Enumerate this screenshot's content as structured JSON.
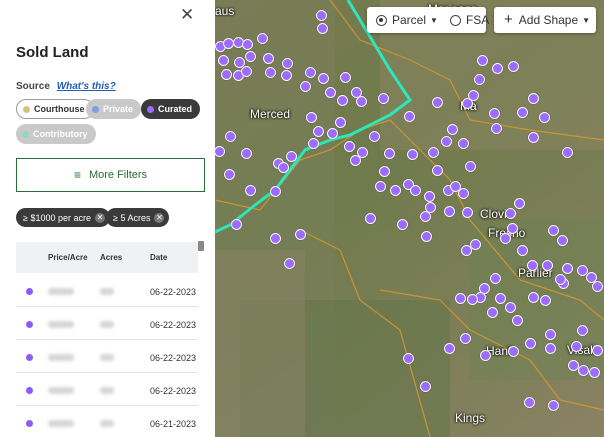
{
  "panel": {
    "title": "Sold Land",
    "source_label": "Source",
    "whats_this": "What's this?",
    "source_chips": [
      {
        "label": "Courthouse",
        "dot": "#d9c08a",
        "state": "outline"
      },
      {
        "label": "Private",
        "dot": "#7aa2e0",
        "state": "disabled"
      },
      {
        "label": "Curated",
        "dot": "#9d6bff",
        "state": "selected"
      },
      {
        "label": "Contributory",
        "dot": "#8fd6c8",
        "state": "disabled"
      }
    ],
    "more_filters": "More Filters",
    "active_filters": [
      "≥ $1000 per acre",
      "≥ 5 Acres"
    ],
    "table": {
      "columns": [
        "Price/Acre",
        "Acres",
        "Date"
      ],
      "rows": [
        {
          "date": "06-22-2023"
        },
        {
          "date": "06-22-2023"
        },
        {
          "date": "06-22-2023"
        },
        {
          "date": "06-22-2023"
        },
        {
          "date": "06-21-2023"
        }
      ]
    }
  },
  "map_controls": {
    "parcel": "Parcel",
    "fsa": "FSA",
    "add_shape": "Add Shape",
    "selected_layer": "Parcel"
  },
  "map": {
    "towns": [
      "aus",
      "Mariposa",
      "Merced",
      "Ma",
      "Clovis",
      "Fresno",
      "Parlier",
      "Hanf",
      "Visali",
      "Kings"
    ]
  },
  "colors": {
    "accent_green": "#2e6b3a",
    "dot_purple": "#9d6bff",
    "boundary_teal": "#2ee6b8",
    "county_orange": "#d99a2b"
  }
}
